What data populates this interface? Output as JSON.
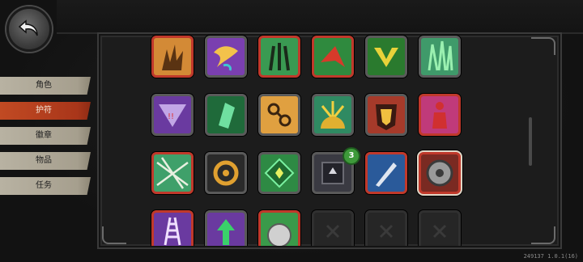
{
  "sidebar": {
    "items": [
      {
        "label": "角色"
      },
      {
        "label": "护符"
      },
      {
        "label": "徽章"
      },
      {
        "label": "物品"
      },
      {
        "label": "任务"
      }
    ],
    "active_index": 1
  },
  "grid": {
    "count_badge": "3"
  },
  "footer": {
    "version": "249137 1.0.1(16)"
  },
  "colors": {
    "accent_active": "#b43e1e",
    "tab_inactive": "#aaa493",
    "border_red": "#c0392b",
    "border_green": "#4a9a3a",
    "badge_green": "#3e9a3a"
  },
  "icons": {
    "back": "undo-arrow-icon"
  }
}
